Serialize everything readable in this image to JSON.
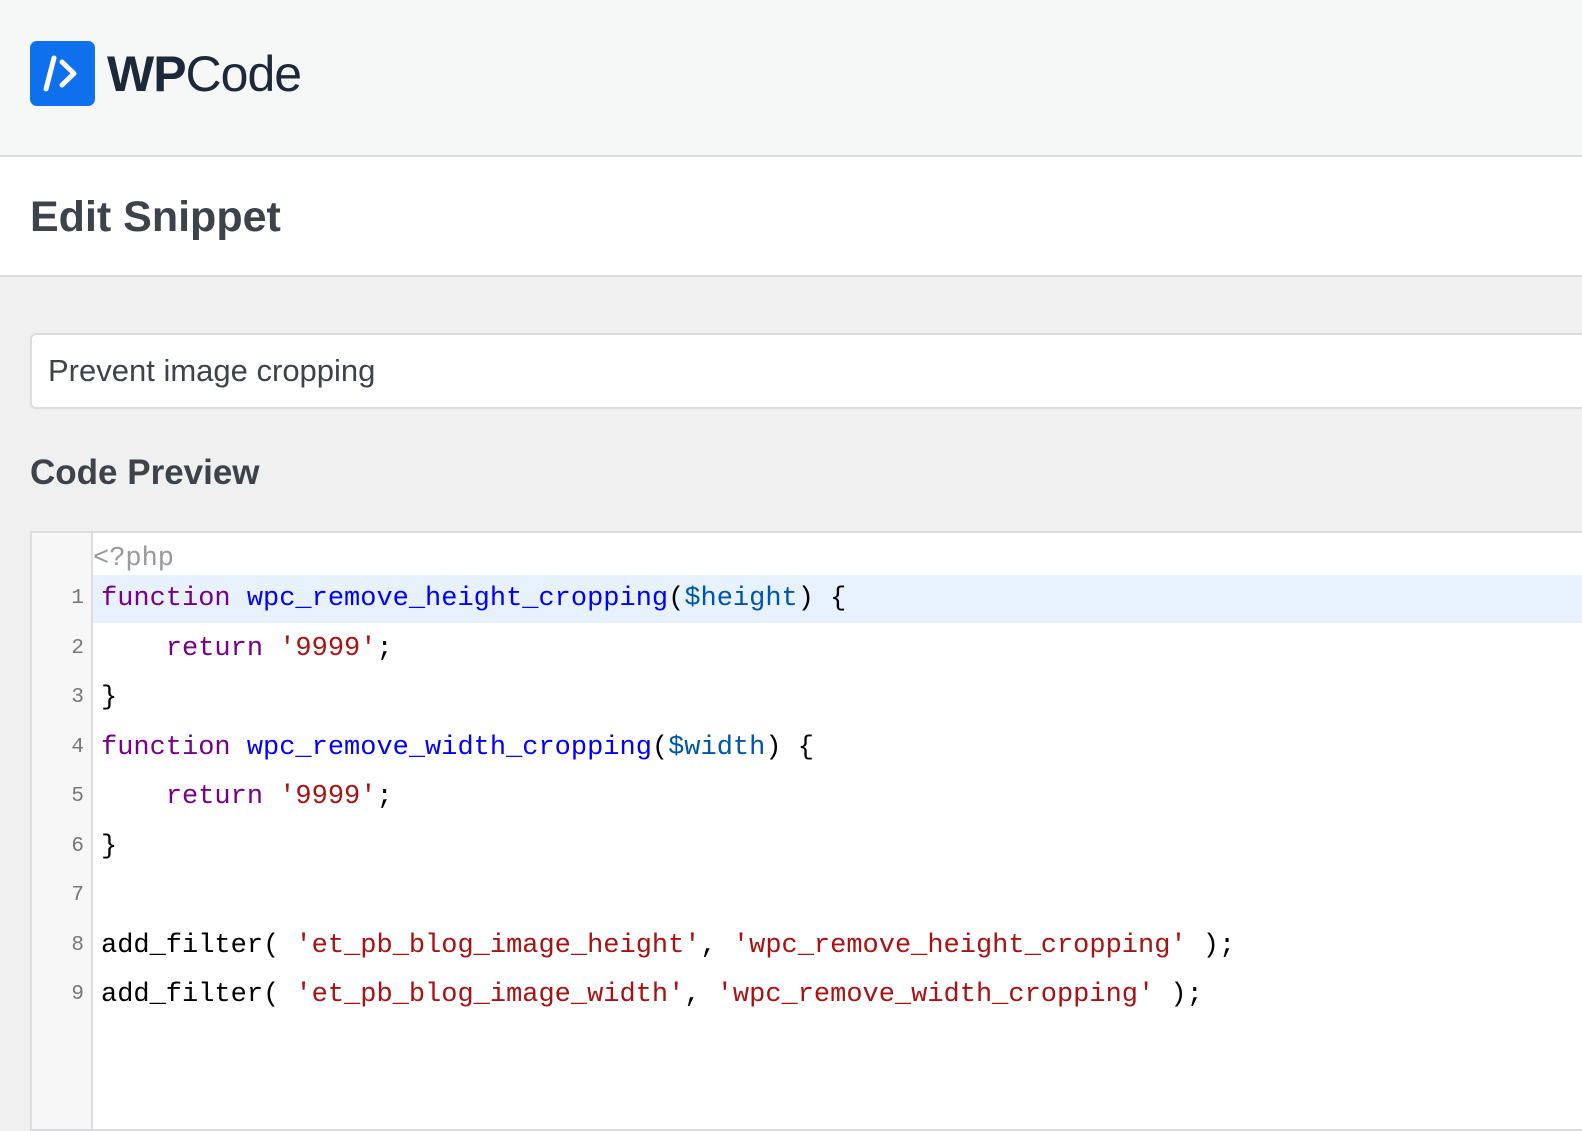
{
  "header": {
    "logo_text_bold": "WP",
    "logo_text_regular": "Code",
    "logo_icon": "wpcode-logo-icon"
  },
  "page": {
    "title": "Edit Snippet"
  },
  "snippet": {
    "title_value": "Prevent image cropping"
  },
  "code_preview": {
    "heading": "Code Preview",
    "php_open_tag": "<?php",
    "active_line": 1,
    "lines": [
      {
        "number": "1",
        "tokens": [
          [
            "kw",
            "function"
          ],
          [
            "",
            ""
          ],
          [
            "fn",
            " wpc_remove_height_cropping"
          ],
          [
            "",
            "("
          ],
          [
            "var",
            "$height"
          ],
          [
            "",
            ") {"
          ]
        ]
      },
      {
        "number": "2",
        "tokens": [
          [
            "",
            "    "
          ],
          [
            "kw",
            "return"
          ],
          [
            "",
            " "
          ],
          [
            "str",
            "'9999'"
          ],
          [
            "",
            ";"
          ]
        ]
      },
      {
        "number": "3",
        "tokens": [
          [
            "",
            "}"
          ]
        ]
      },
      {
        "number": "4",
        "tokens": [
          [
            "kw",
            "function"
          ],
          [
            "fn",
            " wpc_remove_width_cropping"
          ],
          [
            "",
            "("
          ],
          [
            "var",
            "$width"
          ],
          [
            "",
            ") {"
          ]
        ]
      },
      {
        "number": "5",
        "tokens": [
          [
            "",
            "    "
          ],
          [
            "kw",
            "return"
          ],
          [
            "",
            " "
          ],
          [
            "str",
            "'9999'"
          ],
          [
            "",
            ";"
          ]
        ]
      },
      {
        "number": "6",
        "tokens": [
          [
            "",
            "}"
          ]
        ]
      },
      {
        "number": "7",
        "tokens": []
      },
      {
        "number": "8",
        "tokens": [
          [
            "",
            "add_filter( "
          ],
          [
            "str",
            "'et_pb_blog_image_height'"
          ],
          [
            "",
            ", "
          ],
          [
            "str",
            "'wpc_remove_height_cropping'"
          ],
          [
            "",
            " );"
          ]
        ]
      },
      {
        "number": "9",
        "tokens": [
          [
            "",
            "add_filter( "
          ],
          [
            "str",
            "'et_pb_blog_image_width'"
          ],
          [
            "",
            ", "
          ],
          [
            "str",
            "'wpc_remove_width_cropping'"
          ],
          [
            "",
            " );"
          ]
        ]
      }
    ]
  },
  "colors": {
    "brand_blue": "#0f70ee",
    "keyword": "#770088",
    "function_name": "#0000ff",
    "variable": "#0055aa",
    "string": "#aa1111",
    "active_line_bg": "#e8f2ff"
  }
}
